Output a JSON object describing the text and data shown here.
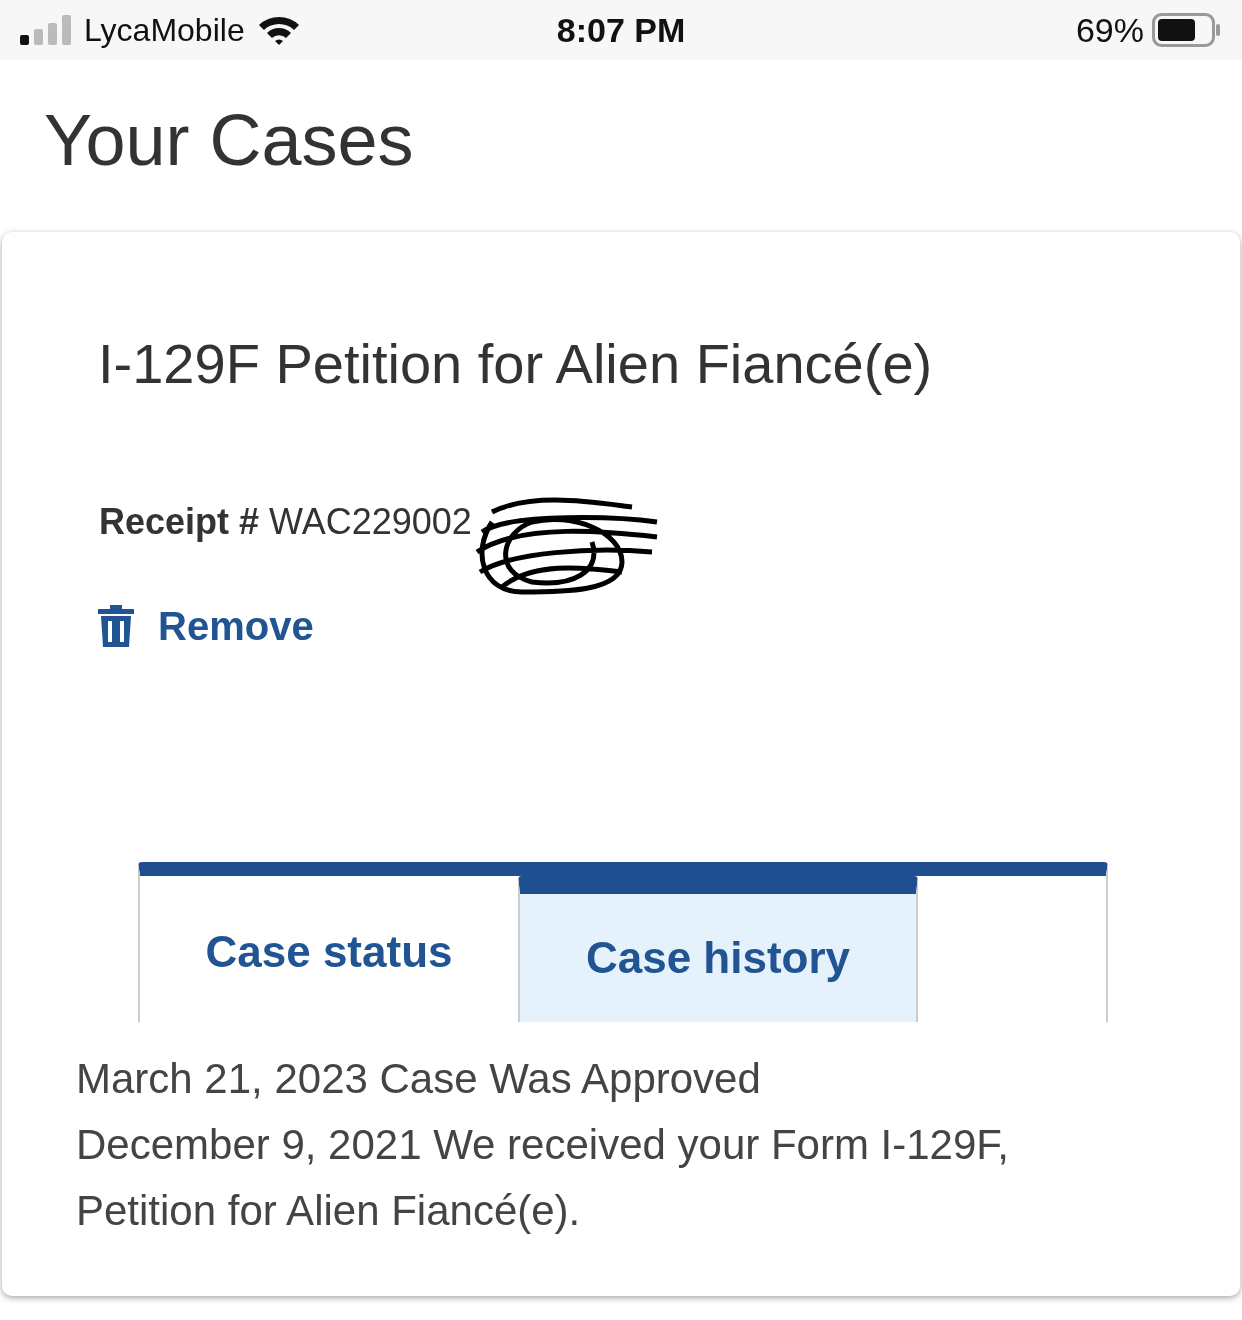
{
  "status_bar": {
    "carrier": "LycaMobile",
    "time": "8:07 PM",
    "battery": "69%"
  },
  "page_title": "Your Cases",
  "case": {
    "title": "I-129F Petition for Alien Fiancé(e)",
    "receipt_label": "Receipt #",
    "receipt_number": "WAC229002",
    "remove": "Remove"
  },
  "tabs": [
    {
      "label": "Case status",
      "selected": false
    },
    {
      "label": "Case history",
      "selected": true
    }
  ],
  "history": [
    "March 21, 2023 Case Was Approved",
    "December 9, 2021 We received your Form I-129F, Petition for Alien Fiancé(e)."
  ]
}
